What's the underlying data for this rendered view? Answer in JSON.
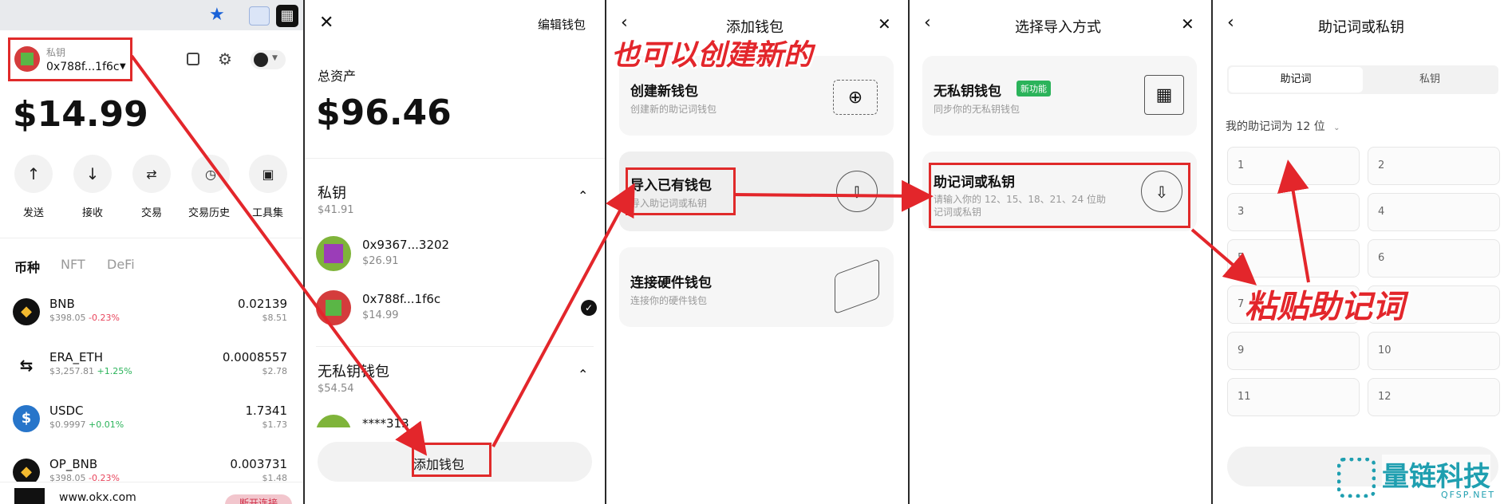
{
  "colors": {
    "accent_red": "#e3262b",
    "positive": "#2bb35a",
    "negative": "#e8455c",
    "chip_green": "#2bb35a",
    "brand_teal": "#1f9fb0"
  },
  "panel1": {
    "account_label": "私钥",
    "address": "0x788f...1f6c",
    "balance": "$14.99",
    "actions": [
      {
        "label": "发送",
        "icon": "arrow-up-icon"
      },
      {
        "label": "接收",
        "icon": "arrow-down-icon"
      },
      {
        "label": "交易",
        "icon": "swap-icon"
      },
      {
        "label": "交易历史",
        "icon": "history-icon"
      },
      {
        "label": "工具集",
        "icon": "tools-icon"
      }
    ],
    "tabs": [
      "币种",
      "NFT",
      "DeFi"
    ],
    "tokens": [
      {
        "name": "BNB",
        "price": "$398.05",
        "change": "-0.23%",
        "amount": "0.02139",
        "value": "$8.51"
      },
      {
        "name": "ERA_ETH",
        "price": "$3,257.81",
        "change": "+1.25%",
        "amount": "0.0008557",
        "value": "$2.78"
      },
      {
        "name": "USDC",
        "price": "$0.9997",
        "change": "+0.01%",
        "amount": "1.7341",
        "value": "$1.73"
      },
      {
        "name": "OP_BNB",
        "price": "$398.05",
        "change": "-0.23%",
        "amount": "0.003731",
        "value": "$1.48"
      }
    ],
    "site": "www.okx.com",
    "disconnect": "断开连接"
  },
  "panel2": {
    "edit_wallet": "编辑钱包",
    "total_label": "总资产",
    "total": "$96.46",
    "group1_title": "私钥",
    "group1_total": "$41.91",
    "accounts": [
      {
        "address": "0x9367...3202",
        "value": "$26.91"
      },
      {
        "address": "0x788f...1f6c",
        "value": "$14.99"
      }
    ],
    "group2_title": "无私钥钱包",
    "group2_total": "$54.54",
    "partial_account": "****313",
    "add_wallet": "添加钱包"
  },
  "panel3": {
    "title": "添加钱包",
    "options": [
      {
        "title": "创建新钱包",
        "desc": "创建新的助记词钱包"
      },
      {
        "title": "导入已有钱包",
        "desc": "导入助记词或私钥"
      },
      {
        "title": "连接硬件钱包",
        "desc": "连接你的硬件钱包"
      }
    ],
    "annotation": "也可以创建新的"
  },
  "panel4": {
    "title": "选择导入方式",
    "options": [
      {
        "title": "无私钥钱包",
        "badge": "新功能",
        "desc": "同步你的无私钥钱包"
      },
      {
        "title": "助记词或私钥",
        "desc": "请输入你的 12、15、18、21、24 位助记词或私钥"
      }
    ]
  },
  "panel5": {
    "title": "助记词或私钥",
    "seg_tabs": [
      "助记词",
      "私钥"
    ],
    "word_count_label": "我的助记词为 12 位",
    "cells": [
      "1",
      "2",
      "3",
      "4",
      "5",
      "6",
      "7",
      "8",
      "9",
      "10",
      "11",
      "12"
    ],
    "annotation": "粘贴助记词"
  },
  "watermark": {
    "name": "量链科技",
    "domain": "QFSP.NET"
  }
}
